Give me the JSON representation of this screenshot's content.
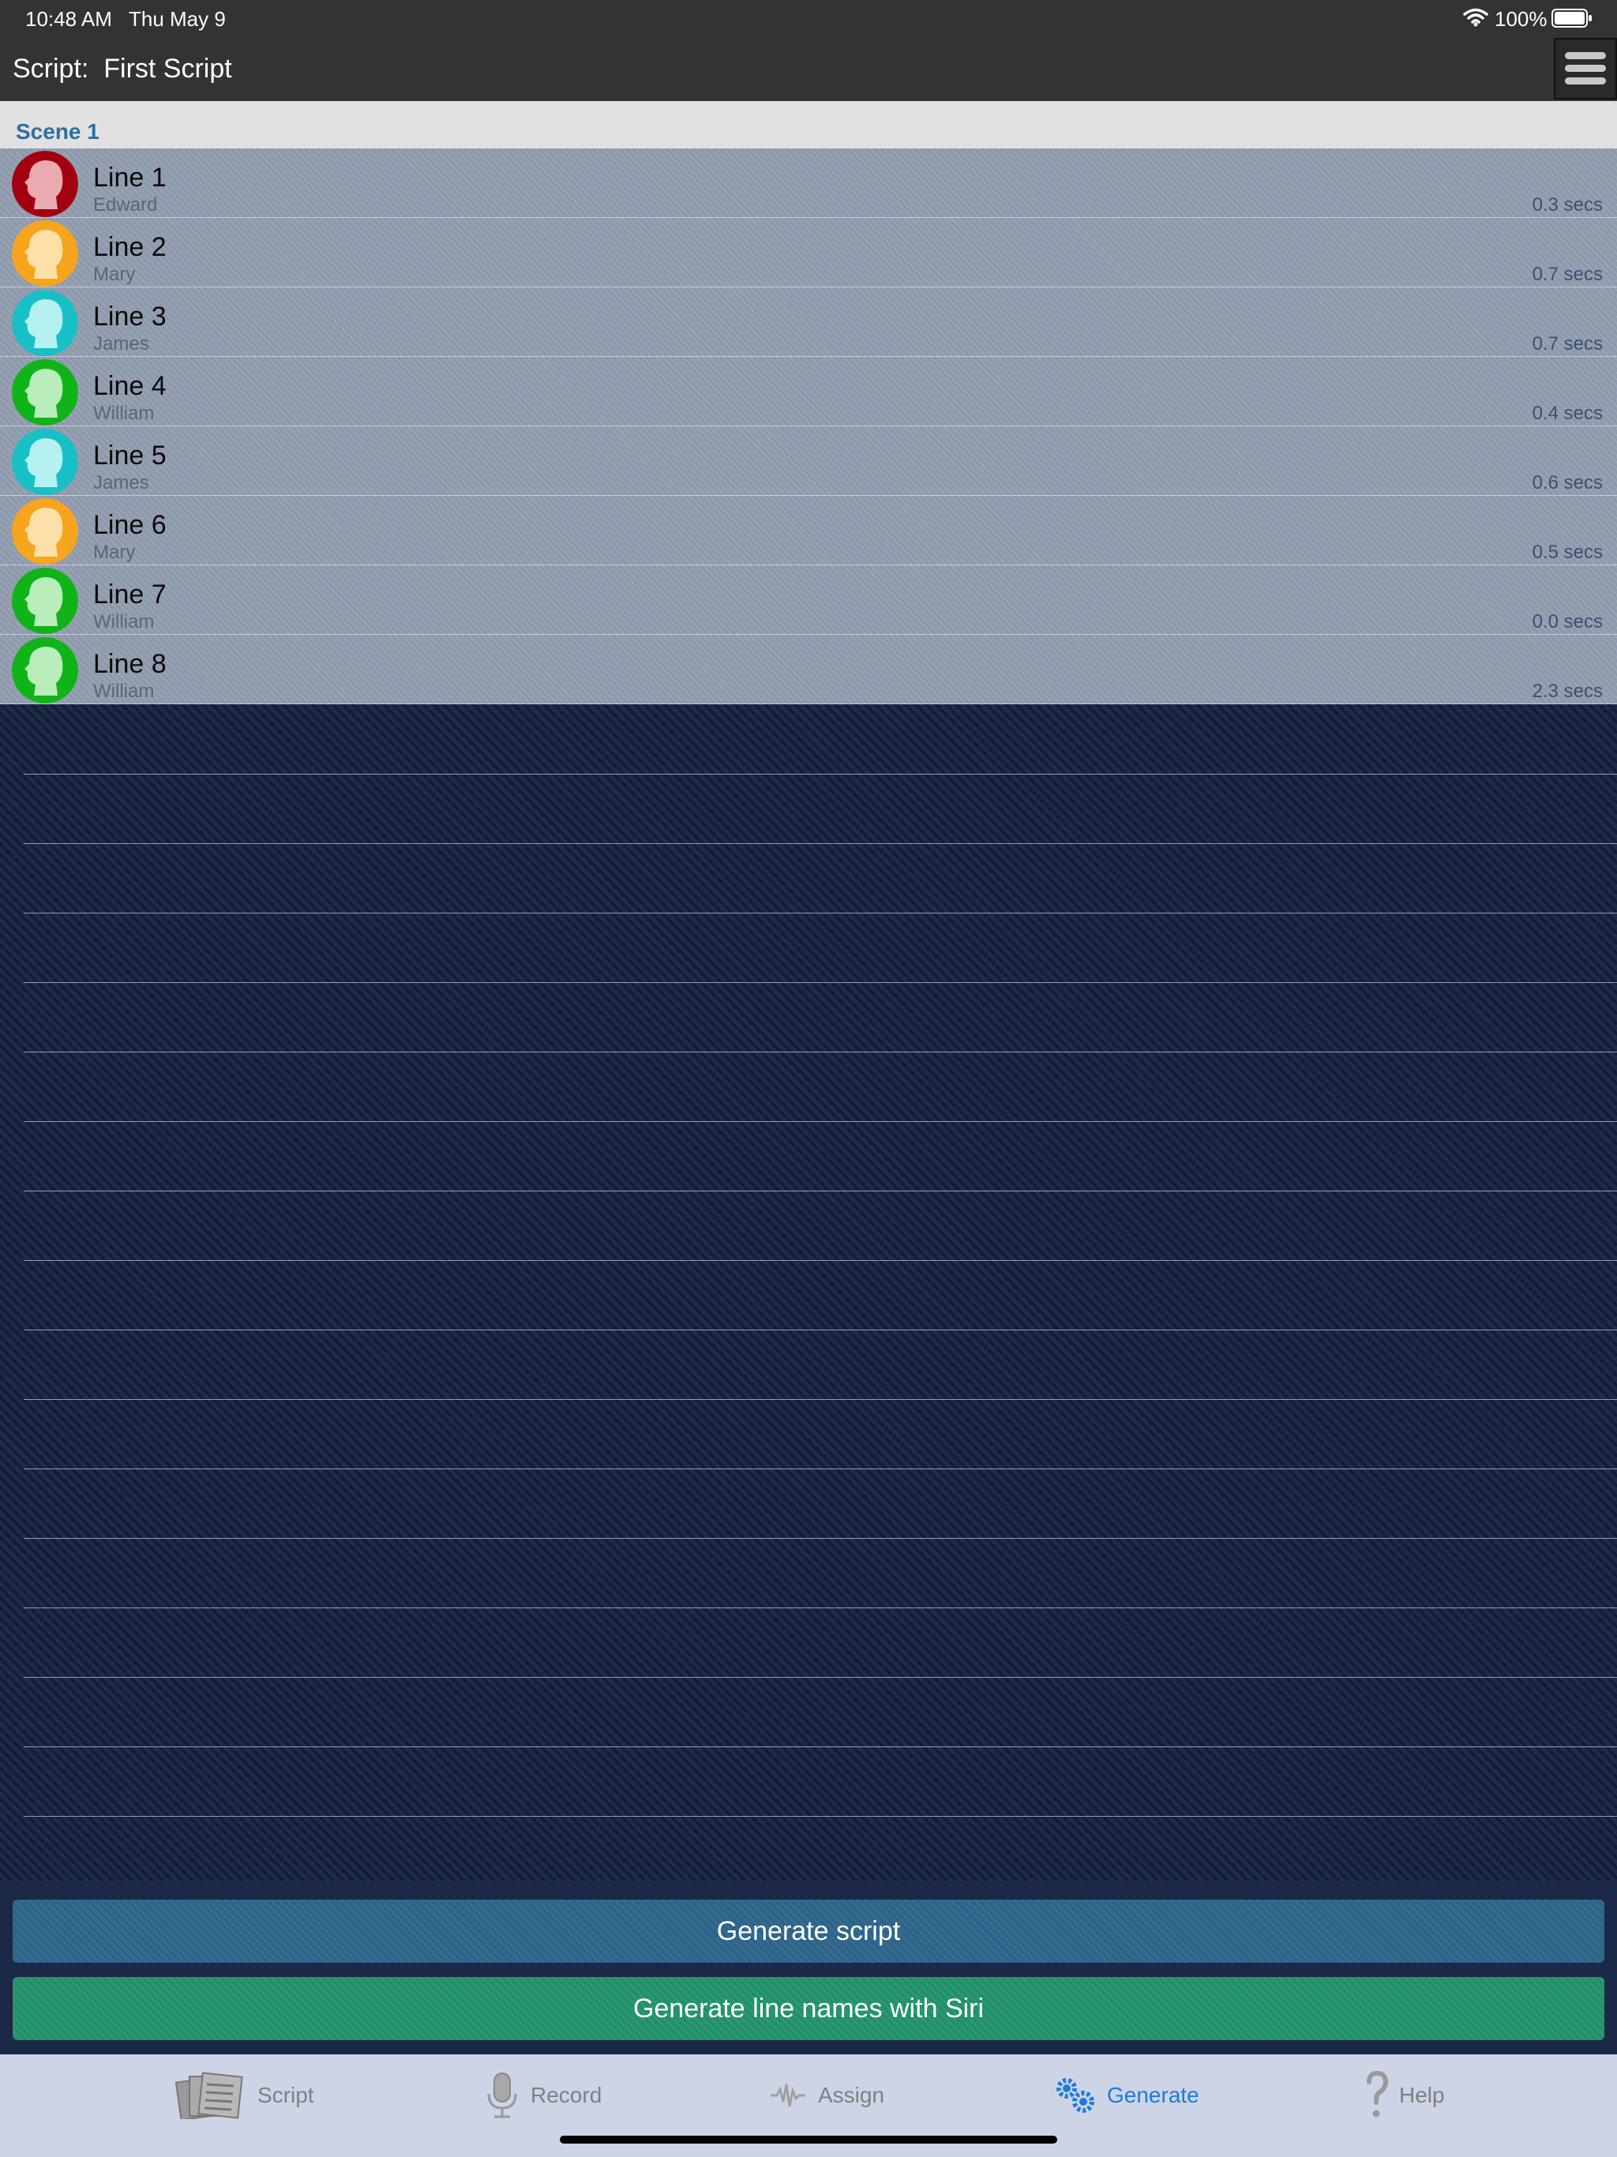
{
  "status_bar": {
    "time": "10:48 AM",
    "date": "Thu May 9",
    "battery": "100%"
  },
  "nav": {
    "title": "Script:  First Script",
    "menu_icon": "hamburger-menu-icon"
  },
  "scene": {
    "title": "Scene 1"
  },
  "lines": [
    {
      "title": "Line 1",
      "character": "Edward",
      "duration": "0.3 secs",
      "color": "#a3000f",
      "face": "#e9aab0"
    },
    {
      "title": "Line 2",
      "character": "Mary",
      "duration": "0.7 secs",
      "color": "#f7a41e",
      "face": "#fde0a8"
    },
    {
      "title": "Line 3",
      "character": "James",
      "duration": "0.7 secs",
      "color": "#19bfc7",
      "face": "#b5f1f1"
    },
    {
      "title": "Line 4",
      "character": "William",
      "duration": "0.4 secs",
      "color": "#10b318",
      "face": "#b9edbb"
    },
    {
      "title": "Line 5",
      "character": "James",
      "duration": "0.6 secs",
      "color": "#19bfc7",
      "face": "#b5f1f1"
    },
    {
      "title": "Line 6",
      "character": "Mary",
      "duration": "0.5 secs",
      "color": "#f7a41e",
      "face": "#fde0a8"
    },
    {
      "title": "Line 7",
      "character": "William",
      "duration": "0.0 secs",
      "color": "#10b318",
      "face": "#b9edbb"
    },
    {
      "title": "Line 8",
      "character": "William",
      "duration": "2.3 secs",
      "color": "#10b318",
      "face": "#b9edbb"
    }
  ],
  "buttons": {
    "generate_script": "Generate script",
    "generate_siri": "Generate line names with Siri"
  },
  "tabs": [
    {
      "label": "Script",
      "icon": "script-pages-icon",
      "active": false
    },
    {
      "label": "Record",
      "icon": "microphone-icon",
      "active": false
    },
    {
      "label": "Assign",
      "icon": "waveform-icon",
      "active": false
    },
    {
      "label": "Generate",
      "icon": "gears-icon",
      "active": true
    },
    {
      "label": "Help",
      "icon": "question-mark-icon",
      "active": false
    }
  ],
  "colors": {
    "active_tab": "#1e7cd8",
    "generate_button": "#2d6489",
    "siri_button": "#22916a"
  }
}
